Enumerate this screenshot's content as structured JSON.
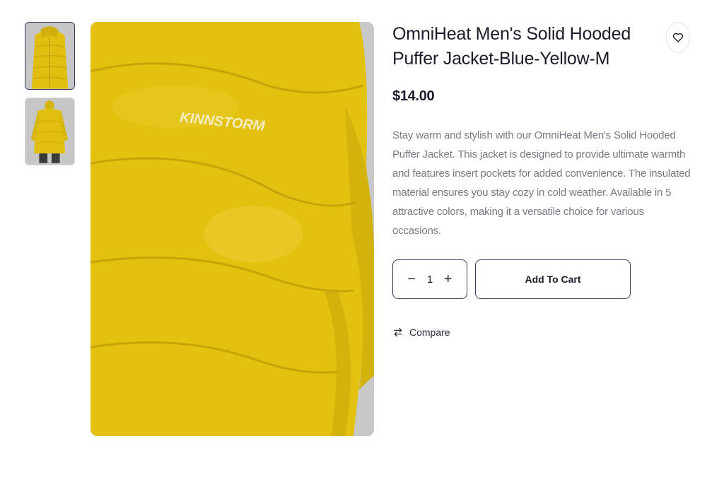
{
  "product": {
    "title": "OmniHeat Men's Solid Hooded Puffer Jacket-Blue-Yellow-M",
    "price": "$14.00",
    "description": "Stay warm and stylish with our OmniHeat Men's Solid Hooded Puffer Jacket. This jacket is designed to provide ultimate warmth and features insert pockets for added convenience. The insulated material ensures you stay cozy in cold weather. Available in 5 attractive colors, making it a versatile choice for various occasions.",
    "image_brand_text": "KINNSTORM"
  },
  "quantity": {
    "minus": "−",
    "value": "1",
    "plus": "+"
  },
  "actions": {
    "add_to_cart": "Add To Cart",
    "compare": "Compare"
  },
  "icons": {
    "wishlist": "heart-icon",
    "compare": "arrows-exchange-icon"
  },
  "colors": {
    "jacket_yellow": "#e3c20f",
    "accent_border": "#3b3a63"
  }
}
